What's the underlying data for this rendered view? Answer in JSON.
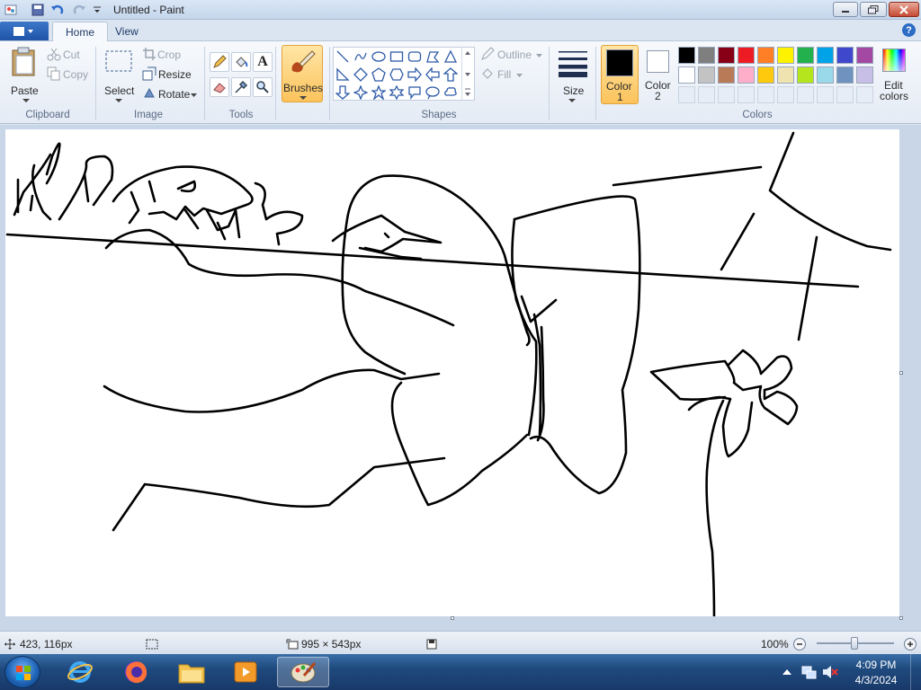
{
  "window": {
    "title": "Untitled - Paint"
  },
  "tabs": [
    {
      "label": "Home"
    },
    {
      "label": "View"
    }
  ],
  "ribbon": {
    "clipboard": {
      "group_label": "Clipboard",
      "paste": "Paste",
      "cut": "Cut",
      "copy": "Copy"
    },
    "image": {
      "group_label": "Image",
      "select": "Select",
      "crop": "Crop",
      "resize": "Resize",
      "rotate": "Rotate"
    },
    "tools": {
      "group_label": "Tools"
    },
    "brushes": {
      "label": "Brushes"
    },
    "shapes": {
      "group_label": "Shapes",
      "outline": "Outline",
      "fill": "Fill"
    },
    "size": {
      "label": "Size"
    },
    "colors": {
      "group_label": "Colors",
      "color1_label": "Color",
      "color1_num": "1",
      "color2_label": "Color",
      "color2_num": "2",
      "edit_label": "Edit",
      "edit_label2": "colors",
      "color1_value": "#000000",
      "color2_value": "#ffffff",
      "palette_row1": [
        "#000000",
        "#7f7f7f",
        "#880015",
        "#ed1c24",
        "#ff7f27",
        "#fff200",
        "#22b14c",
        "#00a2e8",
        "#3f48cc",
        "#a349a4"
      ],
      "palette_row2": [
        "#ffffff",
        "#c3c3c3",
        "#b97a57",
        "#ffaec9",
        "#ffc90e",
        "#efe4b0",
        "#b5e61d",
        "#99d9ea",
        "#7092be",
        "#c8bfe7"
      ]
    }
  },
  "status": {
    "cursor_pos": "423, 116px",
    "canvas_size": "995 × 543px",
    "zoom": "100%"
  },
  "taskbar": {
    "time": "4:09 PM",
    "date": "4/3/2024"
  }
}
